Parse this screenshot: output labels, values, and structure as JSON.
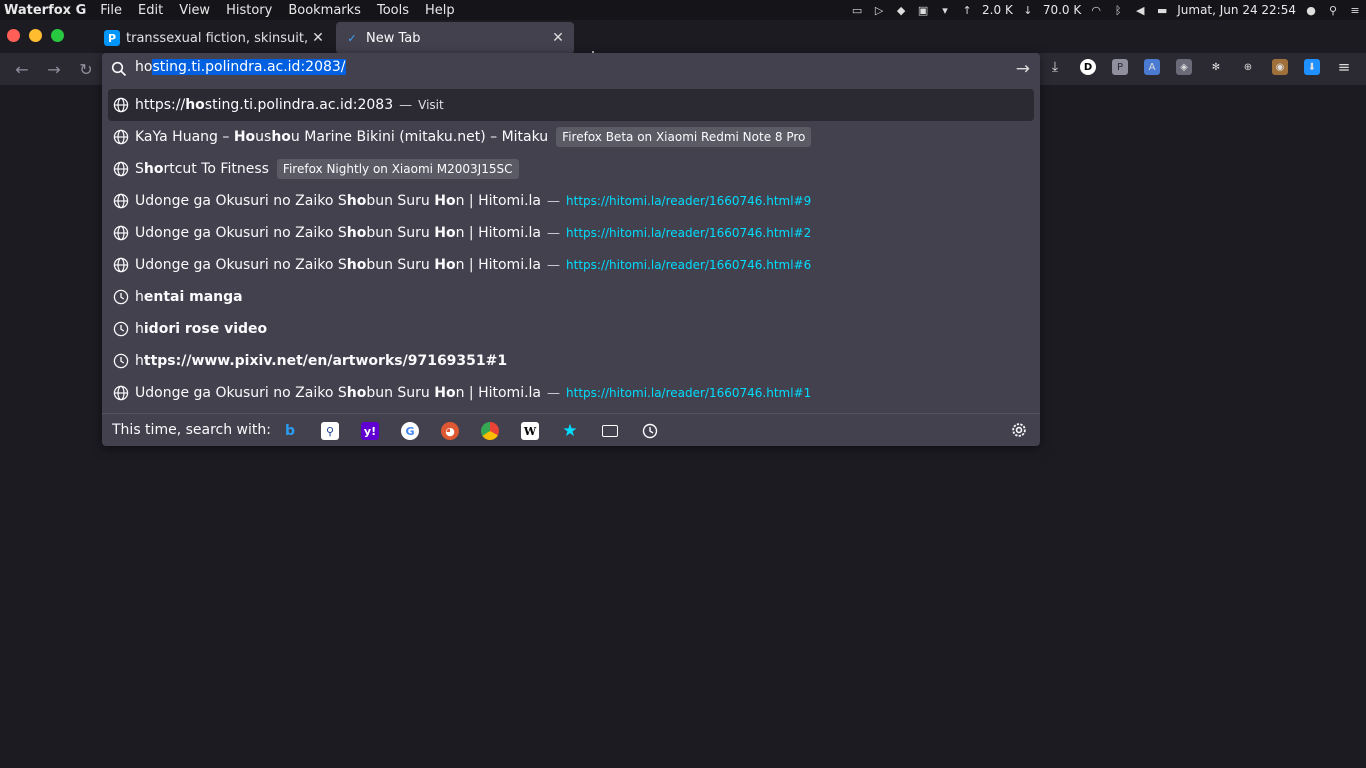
{
  "menubar": {
    "app": "Waterfox G",
    "menus": [
      "File",
      "Edit",
      "View",
      "History",
      "Bookmarks",
      "Tools",
      "Help"
    ],
    "net_up": "2.0 K",
    "net_down": "70.0 K",
    "clock": "Jumat, Jun 24 22:54"
  },
  "tabs": [
    {
      "label": "transsexual fiction, skinsuit, ",
      "icon": "pixiv-favicon"
    },
    {
      "label": "New Tab",
      "icon": "waterfox-icon"
    }
  ],
  "urlbar": {
    "typed": "ho",
    "selected_completion": "sting.ti.polindra.ac.id:2083/"
  },
  "results": [
    {
      "icon": "globe-icon",
      "parts": [
        [
          "https://",
          false
        ],
        [
          "ho",
          true
        ],
        [
          "sting.ti.polindra.ac.id:2083",
          false
        ]
      ],
      "sep": "—",
      "action": "Visit"
    },
    {
      "icon": "globe-icon",
      "parts": [
        [
          "KaYa Huang – ",
          false
        ],
        [
          "Ho",
          true
        ],
        [
          "us",
          false
        ],
        [
          "ho",
          true
        ],
        [
          "u Marine Bikini (mitaku.net) – Mitaku",
          false
        ]
      ],
      "chip": "Firefox Beta on Xiaomi Redmi Note 8 Pro"
    },
    {
      "icon": "globe-icon",
      "parts": [
        [
          "S",
          false
        ],
        [
          "ho",
          true
        ],
        [
          "rtcut To Fitness",
          false
        ]
      ],
      "chip": "Firefox Nightly on Xiaomi M2003J15SC"
    },
    {
      "icon": "globe-icon",
      "parts": [
        [
          "Udonge ga Okusuri no Zaiko S",
          false
        ],
        [
          "ho",
          true
        ],
        [
          "bun Suru ",
          false
        ],
        [
          "Ho",
          true
        ],
        [
          "n | Hitomi.la",
          false
        ]
      ],
      "sep": "—",
      "url": "https://hitomi.la/reader/1660746.html#9"
    },
    {
      "icon": "globe-icon",
      "parts": [
        [
          "Udonge ga Okusuri no Zaiko S",
          false
        ],
        [
          "ho",
          true
        ],
        [
          "bun Suru ",
          false
        ],
        [
          "Ho",
          true
        ],
        [
          "n | Hitomi.la",
          false
        ]
      ],
      "sep": "—",
      "url": "https://hitomi.la/reader/1660746.html#2"
    },
    {
      "icon": "globe-icon",
      "parts": [
        [
          "Udonge ga Okusuri no Zaiko S",
          false
        ],
        [
          "ho",
          true
        ],
        [
          "bun Suru ",
          false
        ],
        [
          "Ho",
          true
        ],
        [
          "n | Hitomi.la",
          false
        ]
      ],
      "sep": "—",
      "url": "https://hitomi.la/reader/1660746.html#6"
    },
    {
      "icon": "history-icon",
      "parts": [
        [
          "h",
          false
        ],
        [
          "entai manga",
          true
        ]
      ]
    },
    {
      "icon": "history-icon",
      "parts": [
        [
          "h",
          false
        ],
        [
          "idori rose video",
          true
        ]
      ]
    },
    {
      "icon": "history-icon",
      "parts": [
        [
          "h",
          false
        ],
        [
          "ttps://www.pixiv.net/en/artworks/97169351#1",
          true
        ]
      ]
    },
    {
      "icon": "globe-icon",
      "parts": [
        [
          "Udonge ga Okusuri no Zaiko S",
          false
        ],
        [
          "ho",
          true
        ],
        [
          "bun Suru ",
          false
        ],
        [
          "Ho",
          true
        ],
        [
          "n | Hitomi.la",
          false
        ]
      ],
      "sep": "—",
      "url": "https://hitomi.la/reader/1660746.html#1"
    }
  ],
  "oneoff": {
    "label": "This time, search with:",
    "engines": [
      "bing-icon",
      "search-engine-icon",
      "yahoo-icon",
      "google-icon",
      "duckduckgo-icon",
      "chrome-web-store-icon",
      "wikipedia-icon",
      "bookmarks-star-icon",
      "tabs-icon",
      "history-clock-icon"
    ]
  },
  "colors": {
    "accent": "#0060df",
    "url_link": "#00ddff",
    "panel": "#42414d",
    "toolbar": "#2b2a33",
    "page": "#1c1b22"
  }
}
